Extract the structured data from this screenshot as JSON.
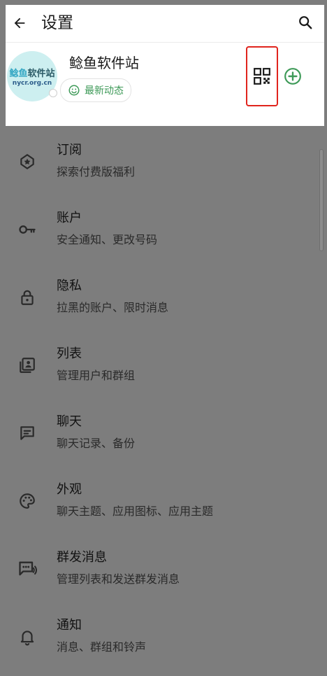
{
  "header": {
    "title": "设置"
  },
  "profile": {
    "name": "鲶鱼软件站",
    "status_label": "最新动态",
    "avatar": {
      "line1_a": "鲶鱼",
      "line1_b": "软件站",
      "line2": "nycr.org.cn"
    }
  },
  "colors": {
    "highlight_box": "#e0241d",
    "accent_green": "#3e9a58",
    "overlay": "#7d7d7d"
  },
  "menu": [
    {
      "icon": "diamond-badge-icon",
      "title": "订阅",
      "subtitle": "探索付费版福利"
    },
    {
      "icon": "key-icon",
      "title": "账户",
      "subtitle": "安全通知、更改号码"
    },
    {
      "icon": "lock-icon",
      "title": "隐私",
      "subtitle": "拉黑的账户、限时消息"
    },
    {
      "icon": "contact-list-icon",
      "title": "列表",
      "subtitle": "管理用户和群组"
    },
    {
      "icon": "chat-icon",
      "title": "聊天",
      "subtitle": "聊天记录、备份"
    },
    {
      "icon": "palette-icon",
      "title": "外观",
      "subtitle": "聊天主题、应用图标、应用主题"
    },
    {
      "icon": "broadcast-icon",
      "title": "群发消息",
      "subtitle": "管理列表和发送群发消息"
    },
    {
      "icon": "bell-icon",
      "title": "通知",
      "subtitle": "消息、群组和铃声"
    }
  ]
}
